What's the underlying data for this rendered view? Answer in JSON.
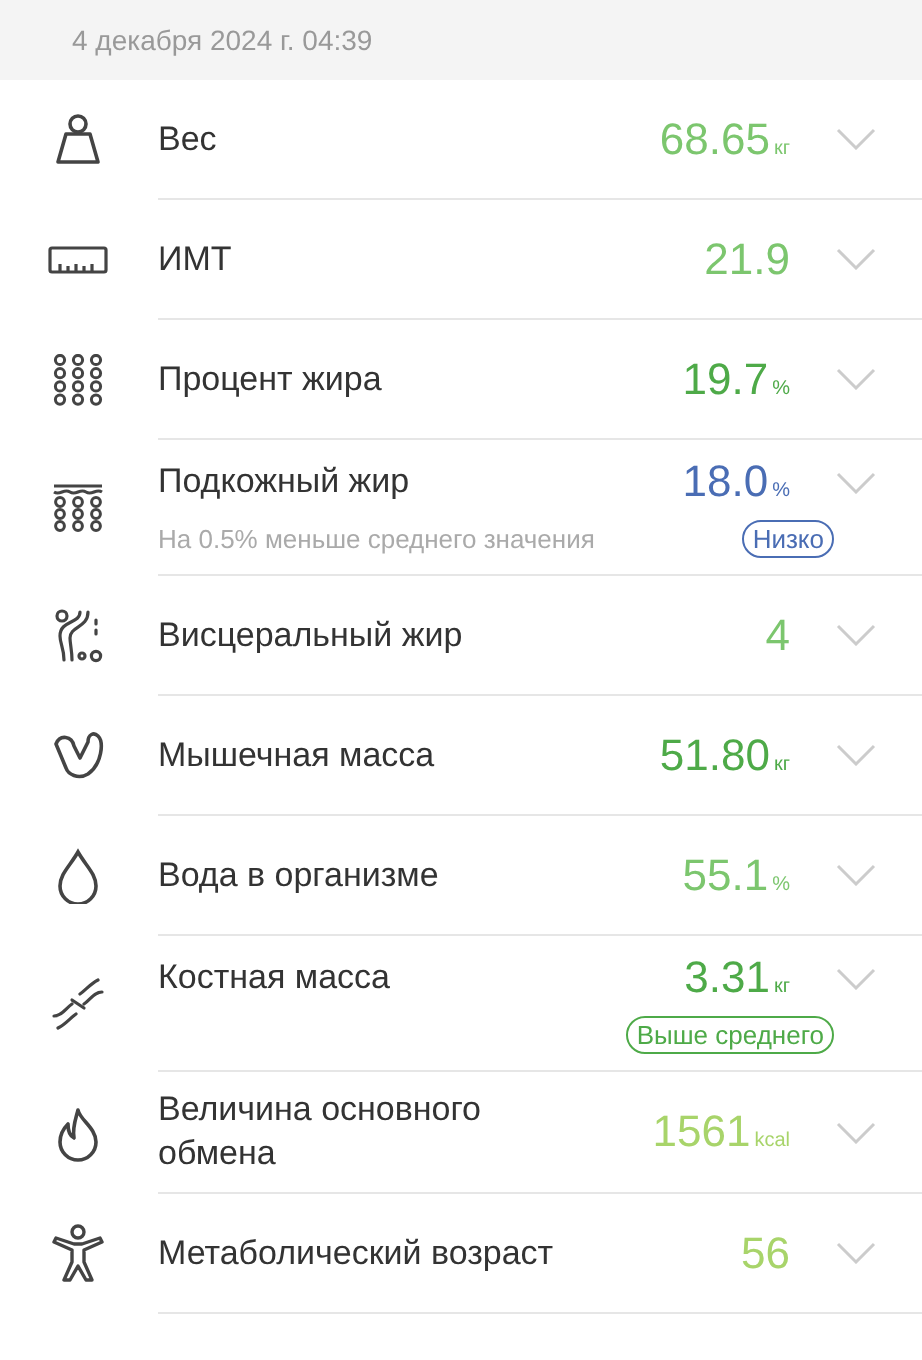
{
  "date": "4 декабря 2024 г. 04:39",
  "metrics": [
    {
      "kind": "weight",
      "label": "Вес",
      "value": "68.65",
      "unit": "кг",
      "color": "#7cc66e"
    },
    {
      "kind": "bmi",
      "label": "ИМТ",
      "value": "21.9",
      "color": "#7cc66e"
    },
    {
      "kind": "fat",
      "label": "Процент жира",
      "value": "19.7",
      "unit": "%",
      "color": "#4eaa48"
    },
    {
      "kind": "subcutaneous",
      "label": "Подкожный жир",
      "value": "18.0",
      "unit": "%",
      "color": "#4a6db4",
      "note": "На 0.5% меньше среднего значения",
      "badge": "Низко"
    },
    {
      "kind": "visceral",
      "label": "Висцеральный жир",
      "value": "4",
      "color": "#7cc66e"
    },
    {
      "kind": "muscle",
      "label": "Мышечная масса",
      "value": "51.80",
      "unit": "кг",
      "color": "#4eaa48"
    },
    {
      "kind": "water",
      "label": "Вода в организме",
      "value": "55.1",
      "unit": "%",
      "color": "#7cc66e"
    },
    {
      "kind": "bone",
      "label": "Костная масса",
      "value": "3.31",
      "unit": "кг",
      "color": "#4eaa48",
      "badge": "Выше среднего"
    },
    {
      "kind": "bmr",
      "label": "Величина основного обмена",
      "value": "1561",
      "unit": "kcal",
      "color": "#a8d46a"
    },
    {
      "kind": "age",
      "label": "Метаболический возраст",
      "value": "56",
      "color": "#a8d46a"
    }
  ]
}
